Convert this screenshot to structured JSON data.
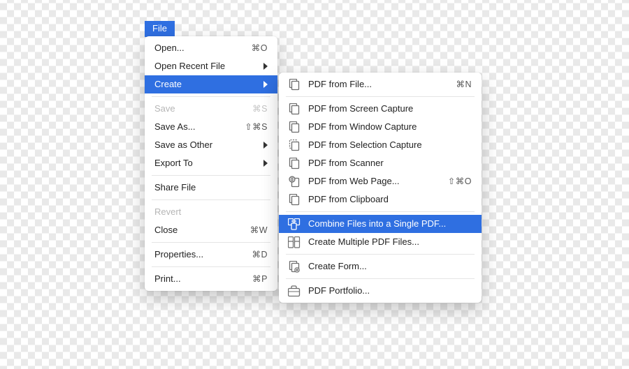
{
  "menubar": {
    "file_label": "File"
  },
  "file_menu": {
    "open": {
      "label": "Open...",
      "shortcut": "⌘O"
    },
    "open_recent": {
      "label": "Open Recent File"
    },
    "create": {
      "label": "Create"
    },
    "save": {
      "label": "Save",
      "shortcut": "⌘S"
    },
    "save_as": {
      "label": "Save As...",
      "shortcut": "⇧⌘S"
    },
    "save_as_other": {
      "label": "Save as Other"
    },
    "export_to": {
      "label": "Export To"
    },
    "share_file": {
      "label": "Share File"
    },
    "revert": {
      "label": "Revert"
    },
    "close": {
      "label": "Close",
      "shortcut": "⌘W"
    },
    "properties": {
      "label": "Properties...",
      "shortcut": "⌘D"
    },
    "print": {
      "label": "Print...",
      "shortcut": "⌘P"
    }
  },
  "create_menu": {
    "pdf_from_file": {
      "label": "PDF from File...",
      "shortcut": "⌘N"
    },
    "pdf_from_screen_capture": {
      "label": "PDF from Screen Capture"
    },
    "pdf_from_window_capture": {
      "label": "PDF from Window Capture"
    },
    "pdf_from_selection_capture": {
      "label": "PDF from Selection Capture"
    },
    "pdf_from_scanner": {
      "label": "PDF from Scanner"
    },
    "pdf_from_web_page": {
      "label": "PDF from Web Page...",
      "shortcut": "⇧⌘O"
    },
    "pdf_from_clipboard": {
      "label": "PDF from Clipboard"
    },
    "combine_files": {
      "label": "Combine Files into a Single PDF..."
    },
    "create_multiple": {
      "label": "Create Multiple PDF Files..."
    },
    "create_form": {
      "label": "Create Form..."
    },
    "pdf_portfolio": {
      "label": "PDF Portfolio..."
    }
  }
}
